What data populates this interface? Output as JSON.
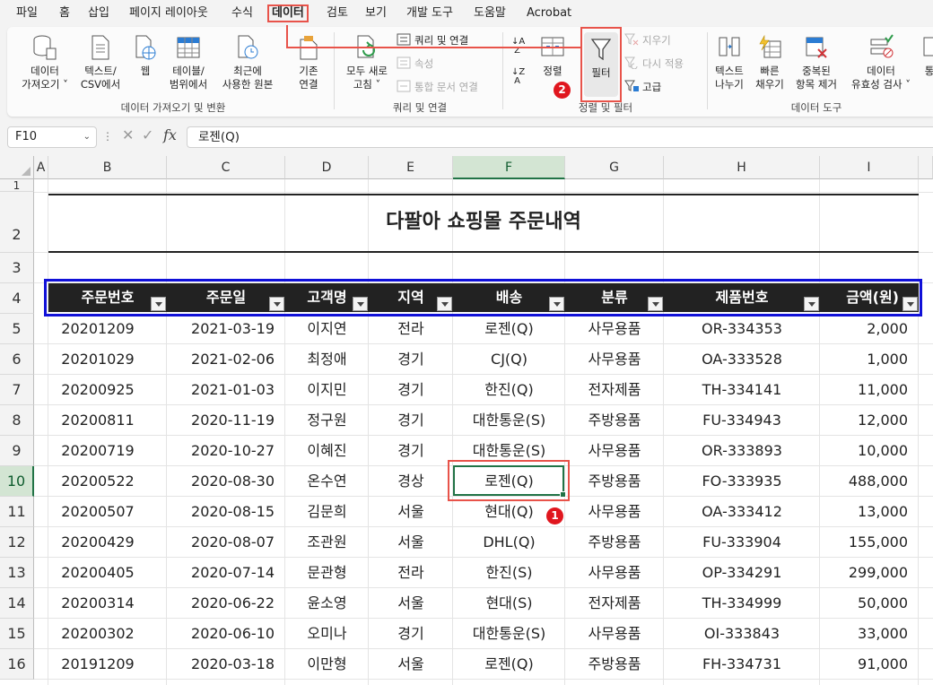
{
  "menu": [
    "파일",
    "홈",
    "삽입",
    "페이지 레이아웃",
    "수식",
    "데이터",
    "검토",
    "보기",
    "개발 도구",
    "도움말",
    "Acrobat"
  ],
  "active_menu": "데이터",
  "ribbon": {
    "get_data": "데이터\n가져오기 ˅",
    "text_csv": "텍스트/\nCSV에서",
    "web": "웹",
    "table_range": "테이블/\n범위에서",
    "recent_source": "최근에\n사용한 원본",
    "existing_conn": "기존\n연결",
    "refresh_all": "모두 새로\n고침 ˅",
    "queries_conn": "쿼리 및 연결",
    "properties": "속성",
    "edit_links": "통합 문서 연결",
    "sort_az": "↓A\n Z",
    "sort_za": "↓Z\n A",
    "sort": "정렬",
    "filter": "필터",
    "clear": "지우기",
    "reapply": "다시 적용",
    "advanced": "고급",
    "text_to_cols": "텍스트\n나누기",
    "flash_fill": "빠른\n채우기",
    "remove_dup": "중복된\n항목 제거",
    "data_validation": "데이터\n유효성 검사 ˅",
    "group_get_data": "데이터 가져오기 및 변환",
    "group_queries": "쿼리 및 연결",
    "group_sort_filter": "정렬 및 필터",
    "group_data_tools": "데이터 도구"
  },
  "formula_bar": {
    "name_box": "F10",
    "fx": "fx",
    "value": "로젠(Q)"
  },
  "columns": [
    "A",
    "B",
    "C",
    "D",
    "E",
    "F",
    "G",
    "H",
    "I"
  ],
  "rows": [
    "1",
    "2",
    "3",
    "4",
    "5",
    "6",
    "7",
    "8",
    "9",
    "10",
    "11",
    "12",
    "13",
    "14",
    "15",
    "16"
  ],
  "sheet_title": "다팔아 쇼핑몰 주문내역",
  "headers": [
    "주문번호",
    "주문일",
    "고객명",
    "지역",
    "배송",
    "분류",
    "제품번호",
    "금액(원)"
  ],
  "data_rows": [
    [
      "20201209",
      "2021-03-19",
      "이지연",
      "전라",
      "로젠(Q)",
      "사무용품",
      "OR-334353",
      "2,000"
    ],
    [
      "20201029",
      "2021-02-06",
      "최정애",
      "경기",
      "CJ(Q)",
      "사무용품",
      "OA-333528",
      "1,000"
    ],
    [
      "20200925",
      "2021-01-03",
      "이지민",
      "경기",
      "한진(Q)",
      "전자제품",
      "TH-334141",
      "11,000"
    ],
    [
      "20200811",
      "2020-11-19",
      "정구원",
      "경기",
      "대한통운(S)",
      "주방용품",
      "FU-334943",
      "12,000"
    ],
    [
      "20200719",
      "2020-10-27",
      "이혜진",
      "경기",
      "대한통운(S)",
      "사무용품",
      "OR-333893",
      "10,000"
    ],
    [
      "20200522",
      "2020-08-30",
      "온수연",
      "경상",
      "로젠(Q)",
      "주방용품",
      "FO-333935",
      "488,000"
    ],
    [
      "20200507",
      "2020-08-15",
      "김문희",
      "서울",
      "현대(Q)",
      "사무용품",
      "OA-333412",
      "13,000"
    ],
    [
      "20200429",
      "2020-08-07",
      "조관원",
      "서울",
      "DHL(Q)",
      "주방용품",
      "FU-333904",
      "155,000"
    ],
    [
      "20200405",
      "2020-07-14",
      "문관형",
      "전라",
      "한진(S)",
      "사무용품",
      "OP-334291",
      "299,000"
    ],
    [
      "20200314",
      "2020-06-22",
      "윤소영",
      "서울",
      "현대(S)",
      "전자제품",
      "TH-334999",
      "50,000"
    ],
    [
      "20200302",
      "2020-06-10",
      "오미나",
      "경기",
      "대한통운(S)",
      "사무용품",
      "OI-333843",
      "33,000"
    ],
    [
      "20191209",
      "2020-03-18",
      "이만형",
      "서울",
      "로젠(Q)",
      "주방용품",
      "FH-334731",
      "91,000"
    ]
  ],
  "annotations": {
    "badge1": "1",
    "badge2": "2"
  },
  "colors": {
    "accent_green": "#217346",
    "highlight_red": "#e8534a",
    "header_black": "#222222",
    "select_blue": "#1010d8"
  }
}
